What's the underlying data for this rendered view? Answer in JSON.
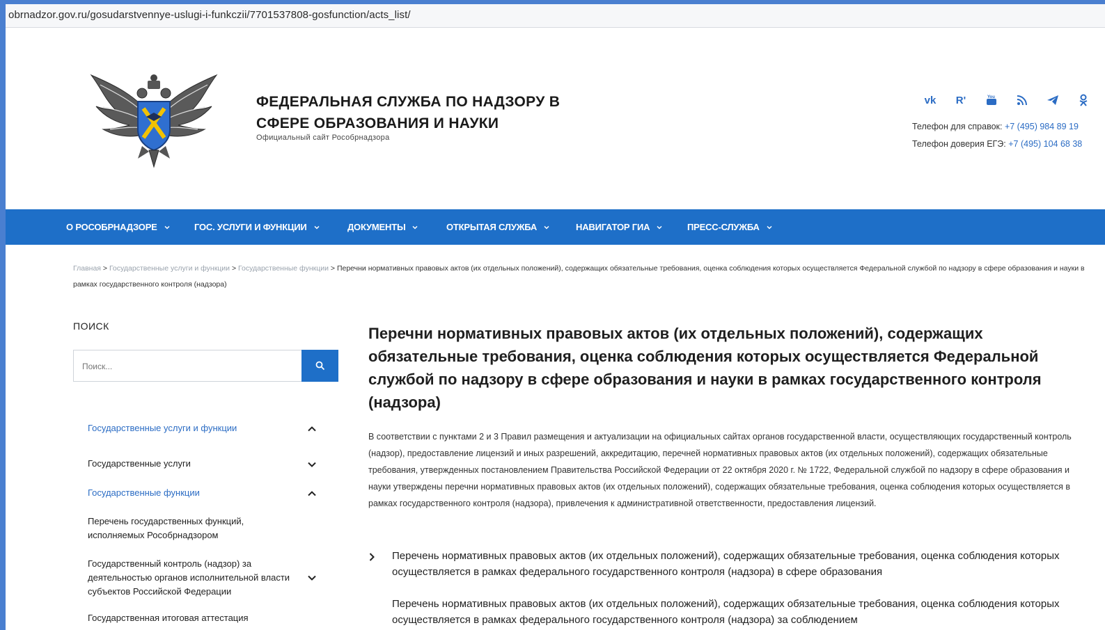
{
  "browser": {
    "url": "obrnadzor.gov.ru/gosudarstvennye-uslugi-i-funkczii/7701537808-gosfunction/acts_list/"
  },
  "header": {
    "title": "ФЕДЕРАЛЬНАЯ СЛУЖБА ПО НАДЗОРУ В СФЕРЕ ОБРАЗОВАНИЯ И НАУКИ",
    "subtitle": "Официальный сайт Рособрнадзора",
    "socials": [
      "vk-icon",
      "rutube-icon",
      "youtube-icon",
      "rss-icon",
      "telegram-icon",
      "odnoklassniki-icon"
    ],
    "contacts": [
      {
        "label": "Телефон для справок: ",
        "phone": "+7 (495) 984 89 19"
      },
      {
        "label": "Телефон доверия ЕГЭ: ",
        "phone": "+7 (495) 104 68 38"
      }
    ]
  },
  "nav": {
    "items": [
      {
        "label": "О РОСОБРНАДЗОРЕ"
      },
      {
        "label": "ГОС. УСЛУГИ И ФУНКЦИИ"
      },
      {
        "label": "ДОКУМЕНТЫ"
      },
      {
        "label": "ОТКРЫТАЯ СЛУЖБА"
      },
      {
        "label": "НАВИГАТОР ГИА"
      },
      {
        "label": "ПРЕСС-СЛУЖБА"
      }
    ]
  },
  "breadcrumb": {
    "links": [
      "Главная",
      "Государственные услуги и функции",
      "Государственные функции"
    ],
    "separator": " > ",
    "current": "Перечни нормативных правовых актов (их отдельных положений), содержащих обязательные требования, оценка соблюдения которых осуществляется Федеральной службой по надзору в сфере образования и науки в рамках государственного контроля (надзора)"
  },
  "sidebar": {
    "title": "ПОИСК",
    "search_placeholder": "Поиск...",
    "items": [
      {
        "label": "Государственные услуги и функции",
        "expanded": true
      },
      {
        "label": "Государственные услуги",
        "expanded": false
      },
      {
        "label": "Государственные функции",
        "expanded": true
      },
      {
        "label": "Перечень государственных функций, исполняемых Рособрнадзором"
      },
      {
        "label": "Государственный контроль (надзор) за деятельностью органов исполнительной власти субъектов Российской Федерации",
        "expanded": false
      },
      {
        "label": "Государственная итоговая аттестация"
      }
    ]
  },
  "main": {
    "title": "Перечни нормативных правовых актов (их отдельных положений), содержащих обязательные требования, оценка соблюдения которых осуществляется Федеральной службой по надзору в сфере образования и науки в рамках государственного контроля (надзора)",
    "intro": "В соответствии с пунктами 2 и 3 Правил размещения и актуализации на официальных сайтах органов государственной власти, осуществляющих государственный контроль (надзор), предоставление лицензий и иных разрешений, аккредитацию, перечней нормативных правовых актов (их отдельных положений), содержащих обязательные требования, утвержденных постановлением Правительства Российской Федерации от 22 октября 2020 г. № 1722, Федеральной службой по надзору в сфере образования и науки утверждены перечни нормативных правовых актов (их отдельных положений), содержащих обязательные требования, оценка соблюдения которых осуществляется в рамках государственного контроля (надзора), привлечения к административной ответственности, предоставления лицензий.",
    "accordion": [
      {
        "label": "Перечень нормативных правовых актов (их отдельных положений), содержащих обязательные требования, оценка соблюдения которых осуществляется в рамках федерального государственного контроля (надзора) в сфере образования"
      },
      {
        "label": "Перечень нормативных правовых актов (их отдельных положений), содержащих обязательные требования, оценка соблюдения которых осуществляется в рамках федерального государственного контроля (надзора) за соблюдением"
      }
    ]
  },
  "colors": {
    "brand_blue": "#1e6fc8",
    "link_blue": "#2b6cc4",
    "breadcrumb_grey": "#9aa3ad"
  }
}
